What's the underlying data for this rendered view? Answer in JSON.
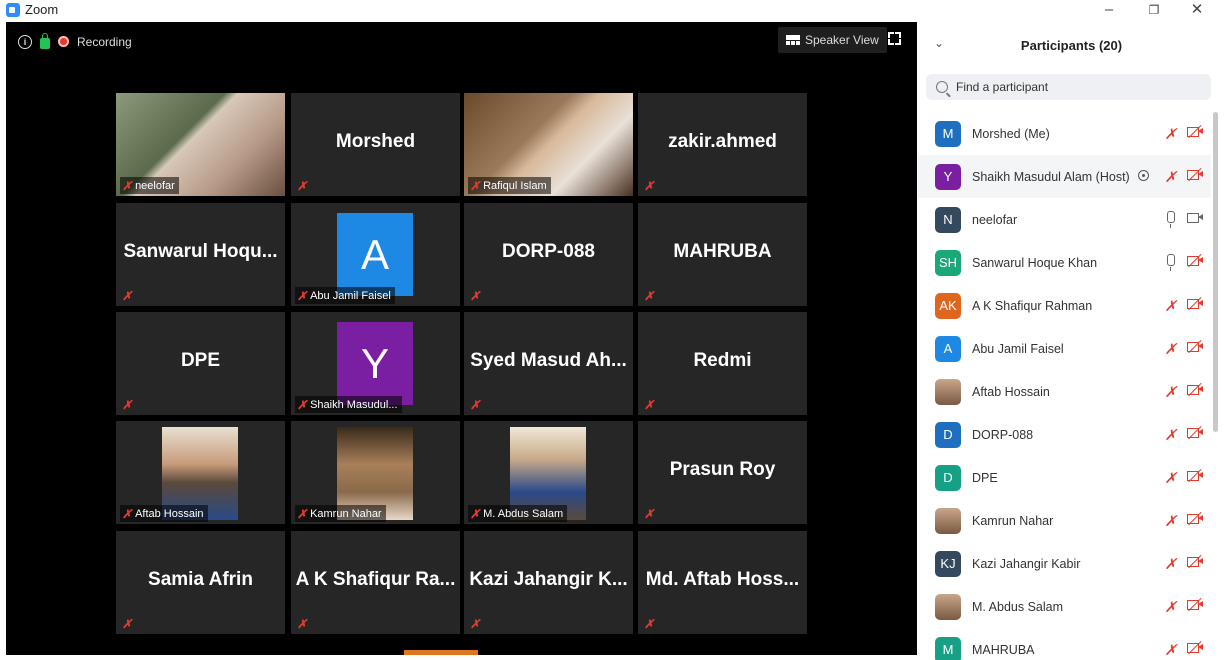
{
  "window": {
    "title": "Zoom",
    "minimize": "–",
    "restore": "❐",
    "close": "✕"
  },
  "toolbar": {
    "info": "i",
    "recording": "Recording",
    "view": "Speaker View"
  },
  "tiles": [
    {
      "name": "",
      "label": "neelofar",
      "type": "photo"
    },
    {
      "name": "Morshed",
      "label": "",
      "type": "name"
    },
    {
      "name": "",
      "label": "Rafiqul Islam",
      "type": "photo"
    },
    {
      "name": "zakir.ahmed",
      "label": "",
      "type": "name"
    },
    {
      "name": "Sanwarul  Hoqu...",
      "label": "",
      "type": "name"
    },
    {
      "name": "A",
      "label": "Abu Jamil Faisel",
      "type": "avatar",
      "color": "#1e88e5"
    },
    {
      "name": "DORP-088",
      "label": "",
      "type": "name"
    },
    {
      "name": "MAHRUBA",
      "label": "",
      "type": "name"
    },
    {
      "name": "DPE",
      "label": "",
      "type": "name"
    },
    {
      "name": "Y",
      "label": "Shaikh Masudul...",
      "type": "avatar",
      "color": "#7b1fa2"
    },
    {
      "name": "Syed  Masud  Ah...",
      "label": "",
      "type": "name"
    },
    {
      "name": "Redmi",
      "label": "",
      "type": "name"
    },
    {
      "name": "",
      "label": "Aftab Hossain",
      "type": "photo"
    },
    {
      "name": "",
      "label": "Kamrun Nahar",
      "type": "photo"
    },
    {
      "name": "",
      "label": "M. Abdus Salam",
      "type": "photo"
    },
    {
      "name": "Prasun Roy",
      "label": "",
      "type": "name"
    },
    {
      "name": "Samia Afrin",
      "label": "",
      "type": "name"
    },
    {
      "name": "A K  Shafiqur Ra...",
      "label": "",
      "type": "name"
    },
    {
      "name": "Kazi  Jahangir  K...",
      "label": "",
      "type": "name"
    },
    {
      "name": "Md.  Aftab  Hoss...",
      "label": "",
      "type": "name"
    }
  ],
  "participants": {
    "title": "Participants (20)",
    "search_placeholder": "Find a participant",
    "list": [
      {
        "initials": "M",
        "name": "Morshed (Me)",
        "color": "#1e6fbf",
        "mic": "off",
        "video": "off"
      },
      {
        "initials": "Y",
        "name": "Shaikh Masudul Alam (Host)",
        "color": "#7b1fa2",
        "mic": "off",
        "video": "off"
      },
      {
        "initials": "N",
        "name": "neelofar",
        "color": "#34495e",
        "mic": "on",
        "video": "on"
      },
      {
        "initials": "SH",
        "name": "Sanwarul Hoque Khan",
        "color": "#1aa87a",
        "mic": "on",
        "video": "off"
      },
      {
        "initials": "AK",
        "name": "A K Shafiqur Rahman",
        "color": "#e0661f",
        "mic": "off",
        "video": "off"
      },
      {
        "initials": "A",
        "name": "Abu Jamil Faisel",
        "color": "#1e88e5",
        "mic": "off",
        "video": "off"
      },
      {
        "initials": "",
        "name": "Aftab Hossain",
        "color": "photo",
        "mic": "off",
        "video": "off"
      },
      {
        "initials": "D",
        "name": "DORP-088",
        "color": "#1e6fbf",
        "mic": "off",
        "video": "off"
      },
      {
        "initials": "D",
        "name": "DPE",
        "color": "#16a085",
        "mic": "off",
        "video": "off"
      },
      {
        "initials": "",
        "name": "Kamrun Nahar",
        "color": "photo",
        "mic": "off",
        "video": "off"
      },
      {
        "initials": "KJ",
        "name": "Kazi Jahangir Kabir",
        "color": "#34495e",
        "mic": "off",
        "video": "off"
      },
      {
        "initials": "",
        "name": "M. Abdus Salam",
        "color": "photo",
        "mic": "off",
        "video": "off"
      },
      {
        "initials": "M",
        "name": "MAHRUBA",
        "color": "#16a085",
        "mic": "off",
        "video": "off"
      }
    ]
  }
}
